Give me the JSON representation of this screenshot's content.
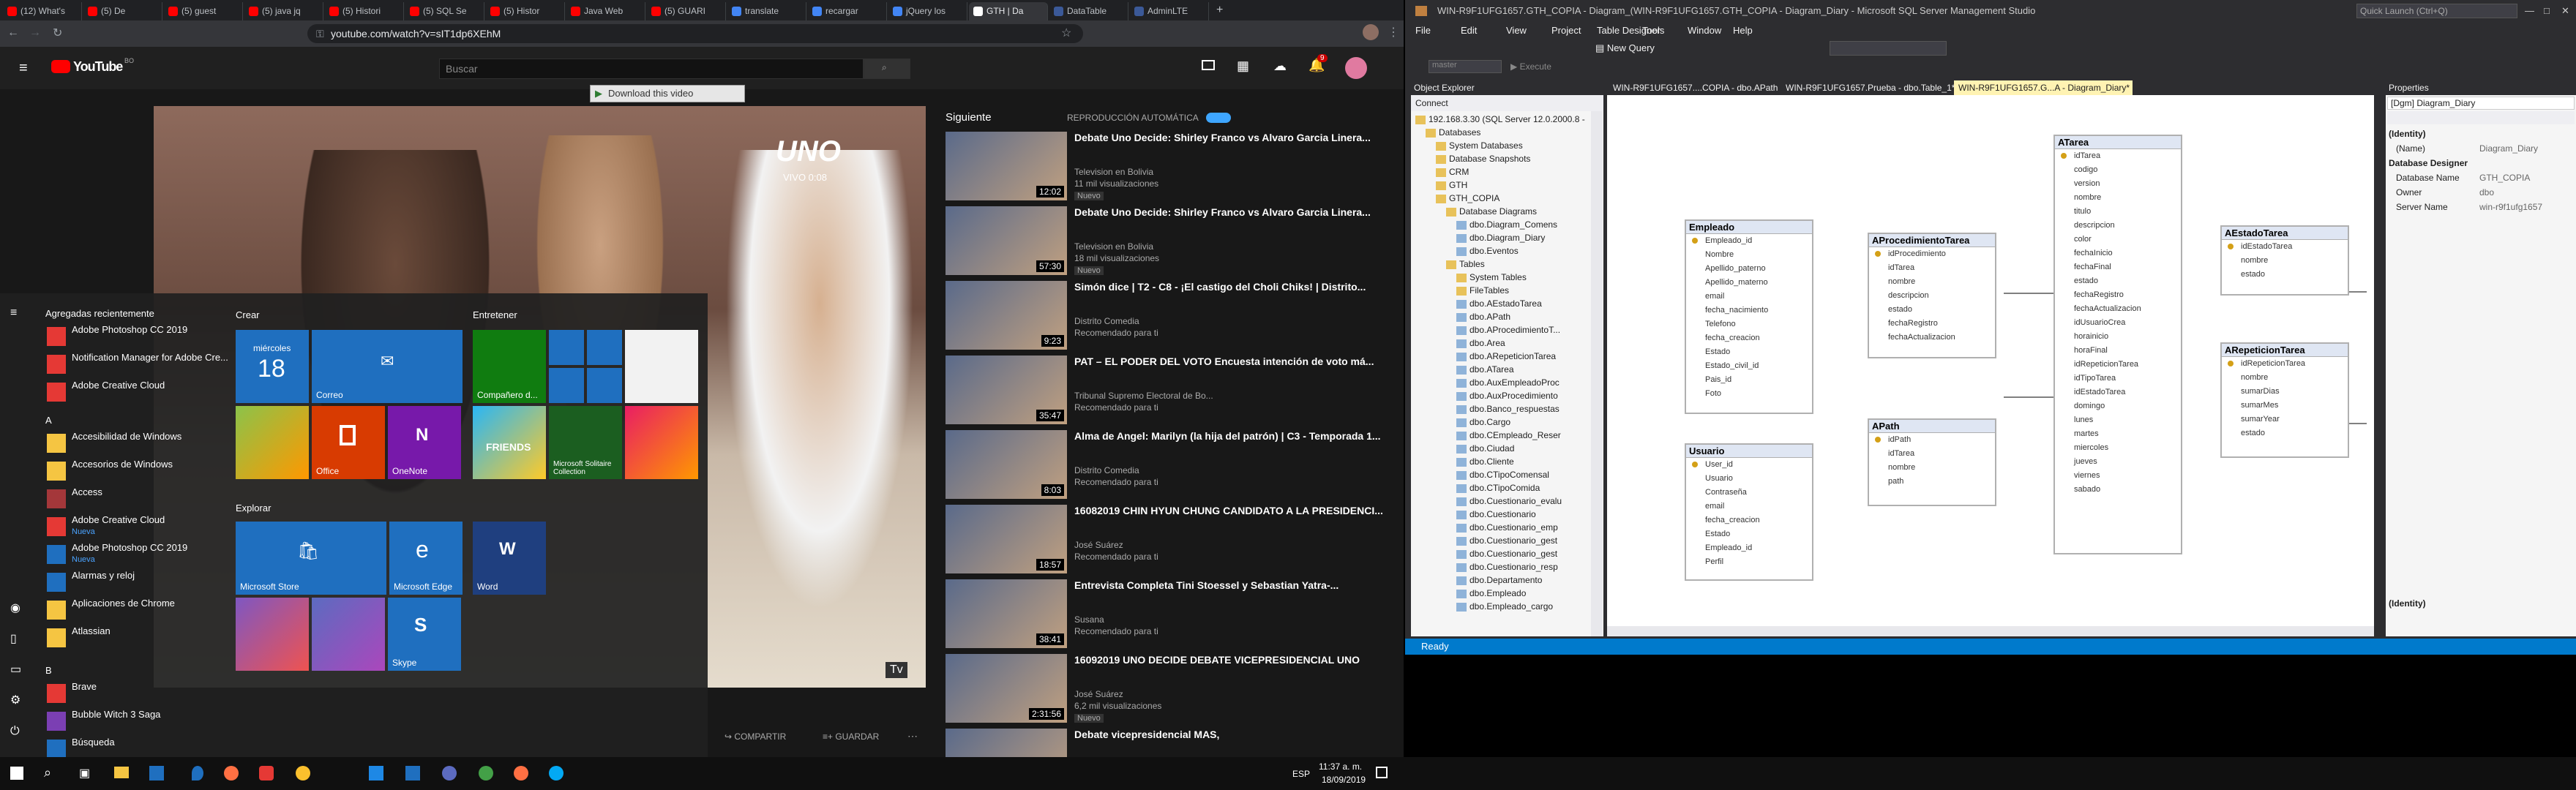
{
  "browser": {
    "tabs": [
      {
        "label": "(12) What's",
        "color": "#ff0000"
      },
      {
        "label": "(5) De",
        "color": "#ff0000"
      },
      {
        "label": "(5) guest",
        "color": "#ff0000"
      },
      {
        "label": "(5) java jq",
        "color": "#ff0000"
      },
      {
        "label": "(5) Histori",
        "color": "#ff0000"
      },
      {
        "label": "(5) SQL Se",
        "color": "#ff0000"
      },
      {
        "label": "(5) Histor",
        "color": "#ff0000"
      },
      {
        "label": "Java Web",
        "color": "#ff0000"
      },
      {
        "label": "(5) GUARI",
        "color": "#ff0000"
      },
      {
        "label": "translate",
        "color": "#4285f4"
      },
      {
        "label": "recargar",
        "color": "#4285f4"
      },
      {
        "label": "jQuery los",
        "color": "#4285f4"
      },
      {
        "label": "GTH | Da",
        "color": "#ffffff"
      },
      {
        "label": "DataTable",
        "color": "#3b5998"
      },
      {
        "label": "AdminLTE",
        "color": "#3b5998"
      }
    ],
    "url": "youtube.com/watch?v=sIT1dp6XEhM"
  },
  "youtube": {
    "logo": "YouTube",
    "logo_sup": "BO",
    "search_placeholder": "Buscar",
    "notif_count": "9",
    "download_label": "Download this video",
    "next_label": "Siguiente",
    "autoplay_label": "REPRODUCCIÓN AUTOMÁTICA",
    "share_label": "COMPARTIR",
    "save_label": "GUARDAR",
    "videos": [
      {
        "title": "Debate Uno Decide: Shirley Franco vs Alvaro Garcia Linera...",
        "channel": "Television en Bolivia",
        "views": "11 mil visualizaciones",
        "badge": "Nuevo",
        "duration": "12:02"
      },
      {
        "title": "Debate Uno Decide: Shirley Franco vs Alvaro Garcia Linera...",
        "channel": "Television en Bolivia",
        "views": "18 mil visualizaciones",
        "badge": "Nuevo",
        "duration": "57:30"
      },
      {
        "title": "Simón dice | T2 - C8 - ¡El castigo del Choli Chiks! | Distrito...",
        "channel": "Distrito Comedia",
        "views": "Recomendado para ti",
        "badge": "",
        "duration": "9:23"
      },
      {
        "title": "PAT – EL PODER DEL VOTO Encuesta intención de voto má...",
        "channel": "Tribunal Supremo Electoral de Bo...",
        "views": "Recomendado para ti",
        "badge": "",
        "duration": "35:47"
      },
      {
        "title": "Alma de Angel: Marilyn (la hija del patrón) | C3 - Temporada 1...",
        "channel": "Distrito Comedia",
        "views": "Recomendado para ti",
        "badge": "",
        "duration": "8:03"
      },
      {
        "title": "16082019 CHIN HYUN CHUNG CANDIDATO A LA PRESIDENCI...",
        "channel": "José Suárez",
        "views": "Recomendado para ti",
        "badge": "",
        "duration": "18:57"
      },
      {
        "title": "Entrevista Completa Tini Stoessel y Sebastian Yatra-...",
        "channel": "Susana",
        "views": "Recomendado para ti",
        "badge": "",
        "duration": "38:41"
      },
      {
        "title": "16092019 UNO DECIDE DEBATE VICEPRESIDENCIAL UNO",
        "channel": "José Suárez",
        "views": "6,2 mil visualizaciones",
        "badge": "Nuevo",
        "duration": "2:31:56"
      },
      {
        "title": "Debate vicepresidencial MAS,",
        "channel": "",
        "views": "",
        "badge": "",
        "duration": ""
      }
    ],
    "tv_logo": "UNO",
    "tv_sub": "VIVO 0:08",
    "tv_corner": "Tv"
  },
  "start_menu": {
    "recent_header": "Agregadas recientemente",
    "apps": [
      {
        "label": "Adobe Photoshop CC 2019",
        "sub": "",
        "color": "#e53935"
      },
      {
        "label": "Notification Manager for Adobe Cre...",
        "sub": "",
        "color": "#e53935"
      },
      {
        "label": "Adobe Creative Cloud",
        "sub": "",
        "color": "#e53935"
      }
    ],
    "letter_a": "A",
    "a_apps": [
      {
        "label": "Accesibilidad de Windows",
        "sub": "",
        "color": "#f5c542"
      },
      {
        "label": "Accesorios de Windows",
        "sub": "",
        "color": "#f5c542"
      },
      {
        "label": "Access",
        "sub": "",
        "color": "#a4373a"
      },
      {
        "label": "Adobe Creative Cloud",
        "sub": "Nueva",
        "color": "#e53935"
      },
      {
        "label": "Adobe Photoshop CC 2019",
        "sub": "Nueva",
        "color": "#1f6fbf"
      },
      {
        "label": "Alarmas y reloj",
        "sub": "",
        "color": "#1f6fbf"
      },
      {
        "label": "Aplicaciones de Chrome",
        "sub": "",
        "color": "#f5c542"
      },
      {
        "label": "Atlassian",
        "sub": "",
        "color": "#f5c542"
      }
    ],
    "letter_b": "B",
    "b_apps": [
      {
        "label": "Brave",
        "sub": "",
        "color": "#e53935"
      },
      {
        "label": "Bubble Witch 3 Saga",
        "sub": "",
        "color": "#7b3fb3"
      },
      {
        "label": "Búsqueda",
        "sub": "",
        "color": "#1f6fbf"
      }
    ],
    "crear": "Crear",
    "entretener": "Entretener",
    "explorar": "Explorar",
    "tiles": {
      "calendar_day": "miércoles",
      "calendar_num": "18",
      "mail": "Correo",
      "office": "Office",
      "onenote": "OneNote",
      "compa": "Compañero d...",
      "solitaire": "Microsoft Solitaire Collection",
      "store": "Microsoft Store",
      "edge": "Microsoft Edge",
      "word": "Word",
      "skype": "Skype",
      "friends": "FRIENDS"
    }
  },
  "taskbar": {
    "time": "11:37 a. m.",
    "date": "18/09/2019",
    "lang": "ESP"
  },
  "ssms": {
    "title": "WIN-R9F1UFG1657.GTH_COPIA - Diagram_(WIN-R9F1UFG1657.GTH_COPIA - Diagram_Diary - Microsoft SQL Server Management Studio",
    "quick_launch": "Quick Launch (Ctrl+Q)",
    "menu": [
      "File",
      "Edit",
      "View",
      "Project",
      "Table Designer",
      "Tools",
      "Window",
      "Help"
    ],
    "new_query": "New Query",
    "execute": "Execute",
    "master": "master",
    "object_explorer": "Object Explorer",
    "connect": "Connect",
    "tree": [
      {
        "label": "192.168.3.30 (SQL Server 12.0.2000.8 -",
        "indent": 0
      },
      {
        "label": "Databases",
        "indent": 1
      },
      {
        "label": "System Databases",
        "indent": 2
      },
      {
        "label": "Database Snapshots",
        "indent": 2
      },
      {
        "label": "CRM",
        "indent": 2
      },
      {
        "label": "GTH",
        "indent": 2
      },
      {
        "label": "GTH_COPIA",
        "indent": 2
      },
      {
        "label": "Database Diagrams",
        "indent": 3
      },
      {
        "label": "dbo.Diagram_Comens",
        "indent": 4
      },
      {
        "label": "dbo.Diagram_Diary",
        "indent": 4
      },
      {
        "label": "dbo.Eventos",
        "indent": 4
      },
      {
        "label": "Tables",
        "indent": 3
      },
      {
        "label": "System Tables",
        "indent": 4
      },
      {
        "label": "FileTables",
        "indent": 4
      },
      {
        "label": "dbo.AEstadoTarea",
        "indent": 4
      },
      {
        "label": "dbo.APath",
        "indent": 4
      },
      {
        "label": "dbo.AProcedimientoT...",
        "indent": 4
      },
      {
        "label": "dbo.Area",
        "indent": 4
      },
      {
        "label": "dbo.ARepeticionTarea",
        "indent": 4
      },
      {
        "label": "dbo.ATarea",
        "indent": 4
      },
      {
        "label": "dbo.AuxEmpleadoProc",
        "indent": 4
      },
      {
        "label": "dbo.AuxProcedimiento",
        "indent": 4
      },
      {
        "label": "dbo.Banco_respuestas",
        "indent": 4
      },
      {
        "label": "dbo.Cargo",
        "indent": 4
      },
      {
        "label": "dbo.CEmpleado_Reser",
        "indent": 4
      },
      {
        "label": "dbo.Ciudad",
        "indent": 4
      },
      {
        "label": "dbo.Cliente",
        "indent": 4
      },
      {
        "label": "dbo.CTipoComensal",
        "indent": 4
      },
      {
        "label": "dbo.CTipoComida",
        "indent": 4
      },
      {
        "label": "dbo.Cuestionario_evalu",
        "indent": 4
      },
      {
        "label": "dbo.Cuestionario",
        "indent": 4
      },
      {
        "label": "dbo.Cuestionario_emp",
        "indent": 4
      },
      {
        "label": "dbo.Cuestionario_gest",
        "indent": 4
      },
      {
        "label": "dbo.Cuestionario_gest",
        "indent": 4
      },
      {
        "label": "dbo.Cuestionario_resp",
        "indent": 4
      },
      {
        "label": "dbo.Departamento",
        "indent": 4
      },
      {
        "label": "dbo.Empleado",
        "indent": 4
      },
      {
        "label": "dbo.Empleado_cargo",
        "indent": 4
      }
    ],
    "doc_tabs": [
      {
        "label": "WIN-R9F1UFG1657....COPIA - dbo.APath",
        "active": false
      },
      {
        "label": "WIN-R9F1UFG1657.Prueba - dbo.Table_1*",
        "active": false
      },
      {
        "label": "WIN-R9F1UFG1657.G...A - Diagram_Diary*",
        "active": true
      }
    ],
    "tables": {
      "empleado": {
        "name": "Empleado",
        "cols": [
          "Empleado_id",
          "Nombre",
          "Apellido_paterno",
          "Apellido_materno",
          "email",
          "fecha_nacimiento",
          "Telefono",
          "fecha_creacion",
          "Estado",
          "Estado_civil_id",
          "Pais_id",
          "Foto"
        ]
      },
      "usuario": {
        "name": "Usuario",
        "cols": [
          "User_id",
          "Usuario",
          "Contraseña",
          "email",
          "fecha_creacion",
          "Estado",
          "Empleado_id",
          "Perfil"
        ]
      },
      "aproc": {
        "name": "AProcedimientoTarea",
        "cols": [
          "idProcedimiento",
          "idTarea",
          "nombre",
          "descripcion",
          "estado",
          "fechaRegistro",
          "fechaActualizacion"
        ]
      },
      "apath": {
        "name": "APath",
        "cols": [
          "idPath",
          "idTarea",
          "nombre",
          "path"
        ]
      },
      "atarea": {
        "name": "ATarea",
        "cols": [
          "idTarea",
          "codigo",
          "version",
          "nombre",
          "titulo",
          "descripcion",
          "color",
          "fechaInicio",
          "fechaFinal",
          "estado",
          "fechaRegistro",
          "fechaActualizacion",
          "idUsuarioCrea",
          "horainicio",
          "horaFinal",
          "idRepeticionTarea",
          "idTipoTarea",
          "idEstadoTarea",
          "domingo",
          "lunes",
          "martes",
          "miercoles",
          "jueves",
          "viernes",
          "sabado"
        ]
      },
      "aestado": {
        "name": "AEstadoTarea",
        "cols": [
          "idEstadoTarea",
          "nombre",
          "estado"
        ]
      },
      "arep": {
        "name": "ARepeticionTarea",
        "cols": [
          "idRepeticionTarea",
          "nombre",
          "sumarDias",
          "sumarMes",
          "sumarYear",
          "estado"
        ]
      }
    },
    "properties": {
      "title": "Properties",
      "object": "[Dgm] Diagram_Diary",
      "rows": [
        {
          "k": "(Identity)",
          "v": "",
          "cat": true
        },
        {
          "k": "(Name)",
          "v": "Diagram_Diary",
          "cat": false
        },
        {
          "k": "Database Designer",
          "v": "",
          "cat": true
        },
        {
          "k": "Database Name",
          "v": "GTH_COPIA",
          "cat": false
        },
        {
          "k": "Owner",
          "v": "dbo",
          "cat": false
        },
        {
          "k": "Server Name",
          "v": "win-r9f1ufg1657",
          "cat": false
        }
      ],
      "footer": "(Identity)"
    },
    "status": "Ready"
  }
}
